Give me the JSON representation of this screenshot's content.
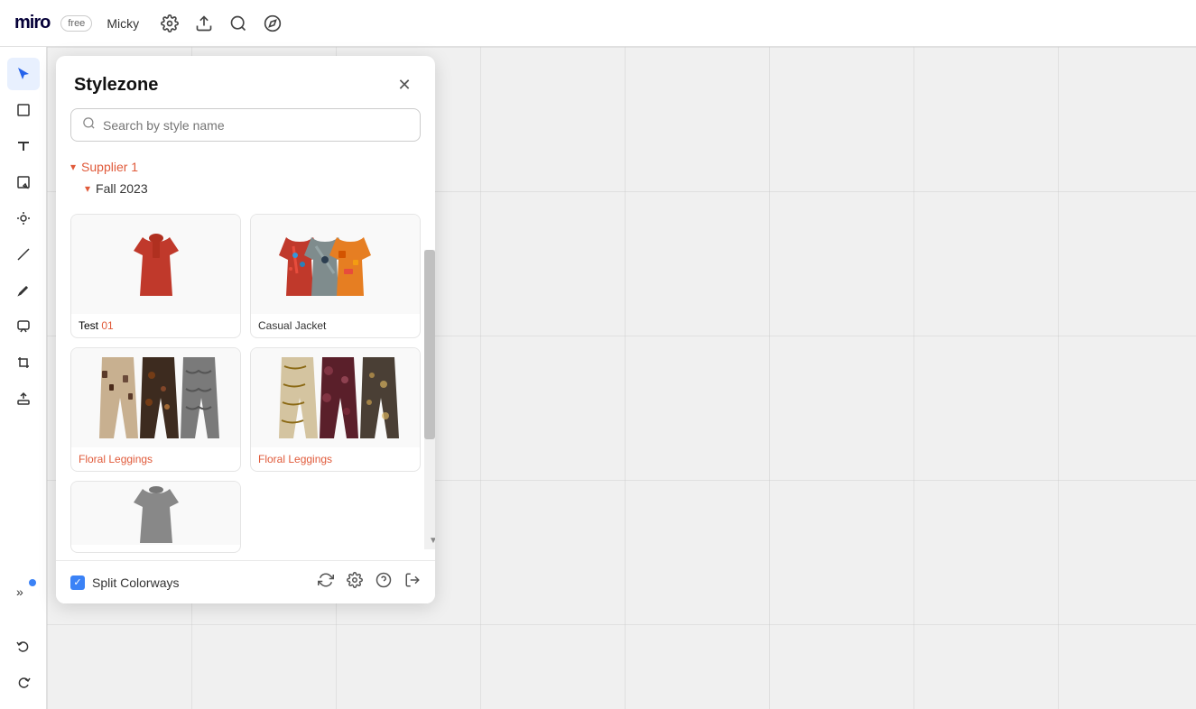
{
  "topbar": {
    "logo": "miro",
    "badge": "free",
    "user": "Micky"
  },
  "toolbar_icons": [
    "⚙",
    "↑",
    "⌕",
    "✦"
  ],
  "panel": {
    "title": "Stylezone",
    "search_placeholder": "Search by style name",
    "supplier": "Supplier 1",
    "season": "Fall 2023",
    "cards": [
      {
        "id": "card-1",
        "label": "Test ",
        "label_suffix": "01",
        "label_suffix_colored": true,
        "has_image": true,
        "img_type": "red-shirt"
      },
      {
        "id": "card-2",
        "label": "Casual Jacket",
        "label_colored": false,
        "has_image": true,
        "img_type": "colorful-jacket"
      },
      {
        "id": "card-3",
        "label": "Floral Leggings",
        "label_colored": true,
        "has_image": true,
        "img_type": "leggings-1"
      },
      {
        "id": "card-4",
        "label": "Floral Leggings",
        "label_colored": true,
        "has_image": true,
        "img_type": "leggings-2"
      },
      {
        "id": "card-5",
        "label": "",
        "label_colored": false,
        "has_image": true,
        "img_type": "gray-jacket"
      }
    ],
    "footer": {
      "split_colorways_label": "Split Colorways",
      "split_colorways_checked": true
    }
  },
  "sidebar_tools": [
    {
      "name": "cursor",
      "icon": "↖",
      "active": true
    },
    {
      "name": "frame",
      "icon": "▭",
      "active": false
    },
    {
      "name": "text",
      "icon": "T",
      "active": false
    },
    {
      "name": "sticky",
      "icon": "▱",
      "active": false
    },
    {
      "name": "link",
      "icon": "⊙",
      "active": false
    },
    {
      "name": "line",
      "icon": "╱",
      "active": false
    },
    {
      "name": "pen",
      "icon": "∧",
      "active": false
    },
    {
      "name": "comment",
      "icon": "☐",
      "active": false
    },
    {
      "name": "crop",
      "icon": "⊞",
      "active": false
    },
    {
      "name": "more",
      "icon": "»",
      "active": false,
      "has_dot": true
    }
  ],
  "bottom_tools": [
    {
      "name": "undo",
      "icon": "↶"
    },
    {
      "name": "redo",
      "icon": "↷"
    }
  ]
}
